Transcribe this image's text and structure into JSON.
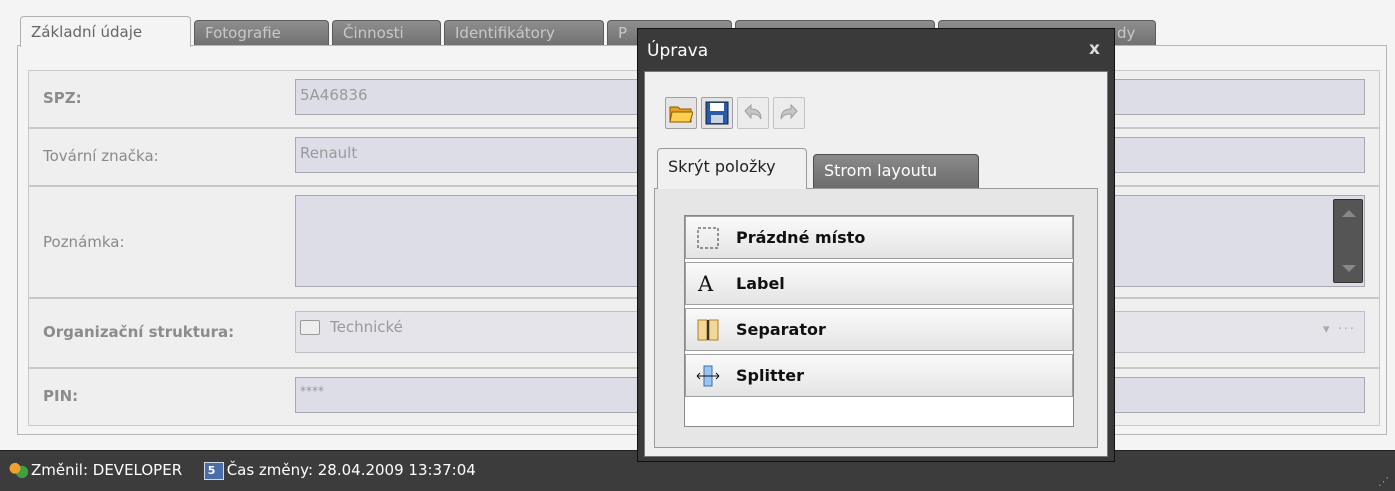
{
  "form": {
    "tabs": [
      {
        "label": "Základní údaje",
        "active": true
      },
      {
        "label": "Fotografie"
      },
      {
        "label": "Činnosti"
      },
      {
        "label": "Identifikátory"
      },
      {
        "label": "P"
      },
      {
        "label": ""
      },
      {
        "label": "dy"
      }
    ],
    "fields": {
      "spz": {
        "label": "SPZ:",
        "value": "5A46836"
      },
      "tovarni_znacka": {
        "label": "Tovární značka:",
        "value": "Renault"
      },
      "poznamka": {
        "label": "Poznámka:",
        "value": ""
      },
      "organizacni_struktura": {
        "label": "Organizační struktura:",
        "value": "Technické",
        "trailing": "▾ ···"
      },
      "pin": {
        "label": "PIN:",
        "value": "****"
      }
    }
  },
  "statusbar": {
    "changed_by": "Změnil: DEVELOPER",
    "change_time": "Čas změny: 28.04.2009 13:37:04",
    "grip": "⋰"
  },
  "dialog": {
    "title": "Úprava",
    "close": "x",
    "toolbar": {
      "icons": [
        "open-folder-icon",
        "save-icon",
        "undo-icon",
        "redo-icon"
      ]
    },
    "tabs": [
      {
        "label": "Skrýt položky",
        "active": true
      },
      {
        "label": "Strom layoutu"
      }
    ],
    "items": [
      {
        "label": "Prázdné místo",
        "icon": "empty-space-icon"
      },
      {
        "label": "Label",
        "icon": "label-icon",
        "glyph": "A"
      },
      {
        "label": "Separator",
        "icon": "separator-icon"
      },
      {
        "label": "Splitter",
        "icon": "splitter-icon"
      }
    ]
  },
  "colors": {
    "statusbar_bg": "#3c3c3c",
    "dialog_frame": "#3a3a3a",
    "input_bg": "#dcdde6"
  }
}
